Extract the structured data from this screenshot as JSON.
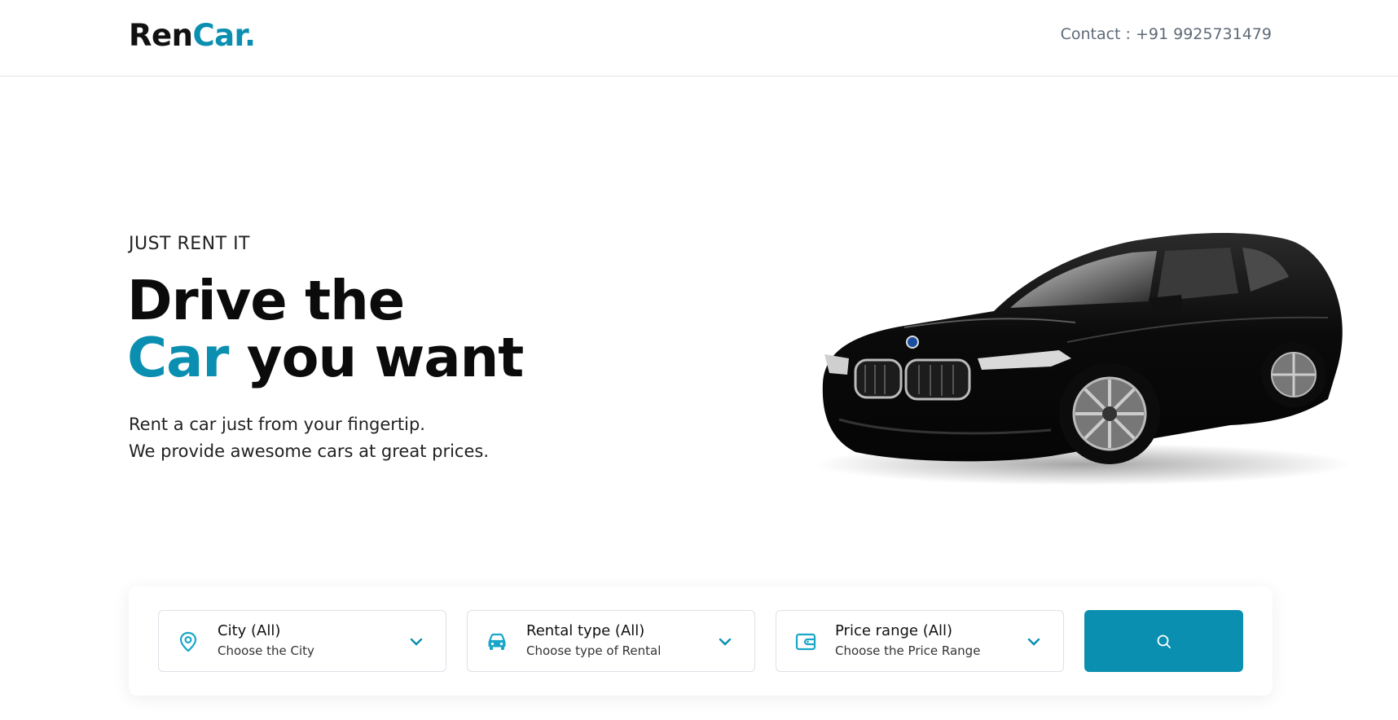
{
  "header": {
    "logo_part1": "Ren",
    "logo_part2": "Car.",
    "contact": "Contact : +91 9925731479"
  },
  "hero": {
    "tagline": "JUST RENT IT",
    "headline_line1": "Drive the",
    "headline_accent": "Car",
    "headline_rest": " you want",
    "subtext_line1": "Rent a car just from your fingertip.",
    "subtext_line2": "We provide awesome cars at great prices."
  },
  "search": {
    "fields": [
      {
        "title": "City (All)",
        "hint": "Choose the City",
        "icon": "location-pin-icon"
      },
      {
        "title": "Rental type (All)",
        "hint": "Choose type of Rental",
        "icon": "car-icon"
      },
      {
        "title": "Price range (All)",
        "hint": "Choose the Price Range",
        "icon": "wallet-icon"
      }
    ],
    "button_icon": "search-icon"
  },
  "colors": {
    "accent": "#0a8fb0",
    "icon": "#1aa6c8"
  }
}
